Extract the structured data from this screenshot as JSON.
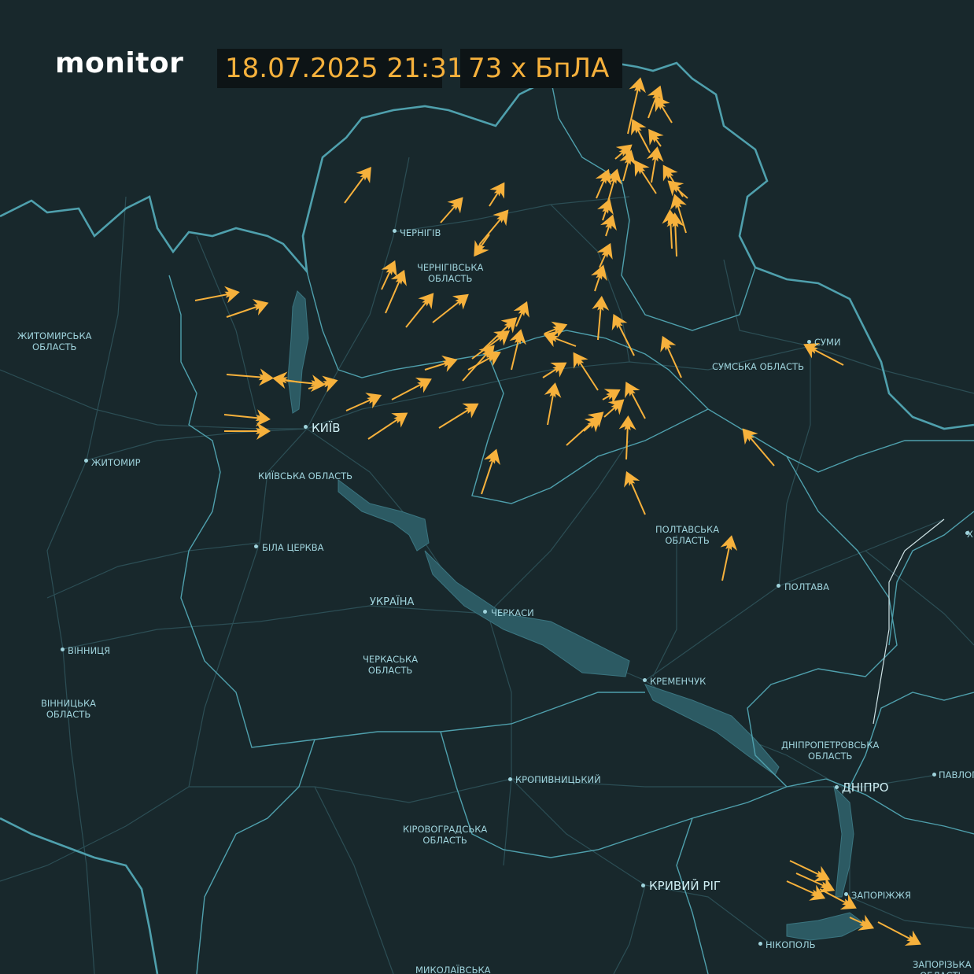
{
  "header": {
    "brand": "monitor",
    "timestamp": "18.07.2025 21:31",
    "drone_count": "73 х БпЛА"
  },
  "colors": {
    "background": "#18282c",
    "border": "#4fa0ad",
    "roads": "#2c4e55",
    "water": "#2c5a63",
    "drone": "#f6b13c"
  },
  "cities": [
    {
      "name": "ЧЕРНІГІВ"
    },
    {
      "name": "КИЇВ"
    },
    {
      "name": "ЖИТОМИР"
    },
    {
      "name": "БІЛА ЦЕРКВА"
    },
    {
      "name": "ЧЕРКАСИ"
    },
    {
      "name": "КРЕМЕНЧУК"
    },
    {
      "name": "ПОЛТАВА"
    },
    {
      "name": "СУМИ"
    },
    {
      "name": "ВІННИЦЯ"
    },
    {
      "name": "КРОПИВНИЦЬКИЙ"
    },
    {
      "name": "ДНІПРО"
    },
    {
      "name": "КРИВИЙ РІГ"
    },
    {
      "name": "ЗАПОРІЖЖЯ"
    },
    {
      "name": "НІКОПОЛЬ"
    },
    {
      "name": "ПАВЛОГ"
    },
    {
      "name": "Х"
    }
  ],
  "regions": [
    {
      "name": "ЖИТОМИРСЬКА\nОБЛАСТЬ"
    },
    {
      "name": "ЧЕРНІГІВСЬКА\nОБЛАСТЬ"
    },
    {
      "name": "КИЇВСЬКА ОБЛАСТЬ"
    },
    {
      "name": "СУМСЬКА ОБЛАСТЬ"
    },
    {
      "name": "ПОЛТАВСЬКА\nОБЛАСТЬ"
    },
    {
      "name": "УКРАЇНА"
    },
    {
      "name": "ЧЕРКАСЬКА\nОБЛАСТЬ"
    },
    {
      "name": "ВІННИЦЬКА\nОБЛАСТЬ"
    },
    {
      "name": "ДНІПРОПЕТРОВСЬКА\nОБЛАСТЬ"
    },
    {
      "name": "КІРОВОГРАДСЬКА\nОБЛАСТЬ"
    },
    {
      "name": "МИКОЛАЇВСЬКА"
    },
    {
      "name": "ЗАПОРІЗЬКА\nОБЛАСТЬ"
    }
  ]
}
